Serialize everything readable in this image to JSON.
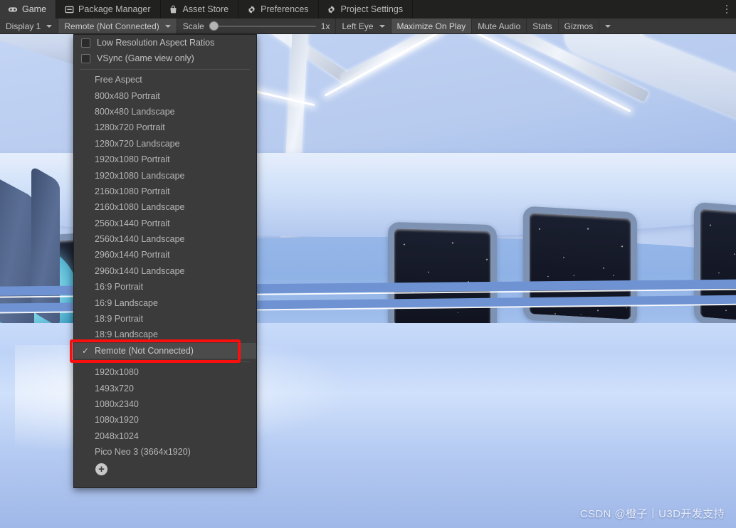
{
  "window": {
    "tabs": [
      {
        "label": "Game",
        "icon": "gamepad-icon",
        "active": true
      },
      {
        "label": "Package Manager",
        "icon": "package-icon",
        "active": false
      },
      {
        "label": "Asset Store",
        "icon": "shopping-bag-icon",
        "active": false
      },
      {
        "label": "Preferences",
        "icon": "gear-icon",
        "active": false
      },
      {
        "label": "Project Settings",
        "icon": "gear-icon",
        "active": false
      }
    ],
    "overflow_menu_icon": "kebab-menu-icon"
  },
  "toolbar": {
    "display_selector": "Display 1",
    "aspect_selector": "Remote (Not Connected)",
    "scale_label": "Scale",
    "scale_value": "1x",
    "scale_slider_position": 0,
    "eye_selector": "Left Eye",
    "maximize_on_play": "Maximize On Play",
    "mute_audio": "Mute Audio",
    "stats": "Stats",
    "gizmos": "Gizmos"
  },
  "menu": {
    "toggles": [
      {
        "label": "Low Resolution Aspect Ratios",
        "checked": false
      },
      {
        "label": "VSync (Game view only)",
        "checked": false
      }
    ],
    "aspect_items": [
      "Free Aspect",
      "800x480 Portrait",
      "800x480 Landscape",
      "1280x720 Portrait",
      "1280x720 Landscape",
      "1920x1080 Portrait",
      "1920x1080 Landscape",
      "2160x1080 Portrait",
      "2160x1080 Landscape",
      "2560x1440 Portrait",
      "2560x1440 Landscape",
      "2960x1440 Portrait",
      "2960x1440 Landscape",
      "16:9 Portrait",
      "16:9 Landscape",
      "18:9 Portrait",
      "18:9 Landscape"
    ],
    "selected_item": {
      "label": "Remote (Not Connected)",
      "check_glyph": "✓",
      "highlighted": true
    },
    "resolution_items": [
      "1920x1080",
      "1493x720",
      "1080x2340",
      "1080x1920",
      "2048x1024",
      "Pico Neo 3 (3664x1920)"
    ],
    "add_button_label": "+",
    "highlight_color": "#fa0f0f"
  },
  "watermark": {
    "text": "CSDN @橙子丨U3D开发支持"
  }
}
